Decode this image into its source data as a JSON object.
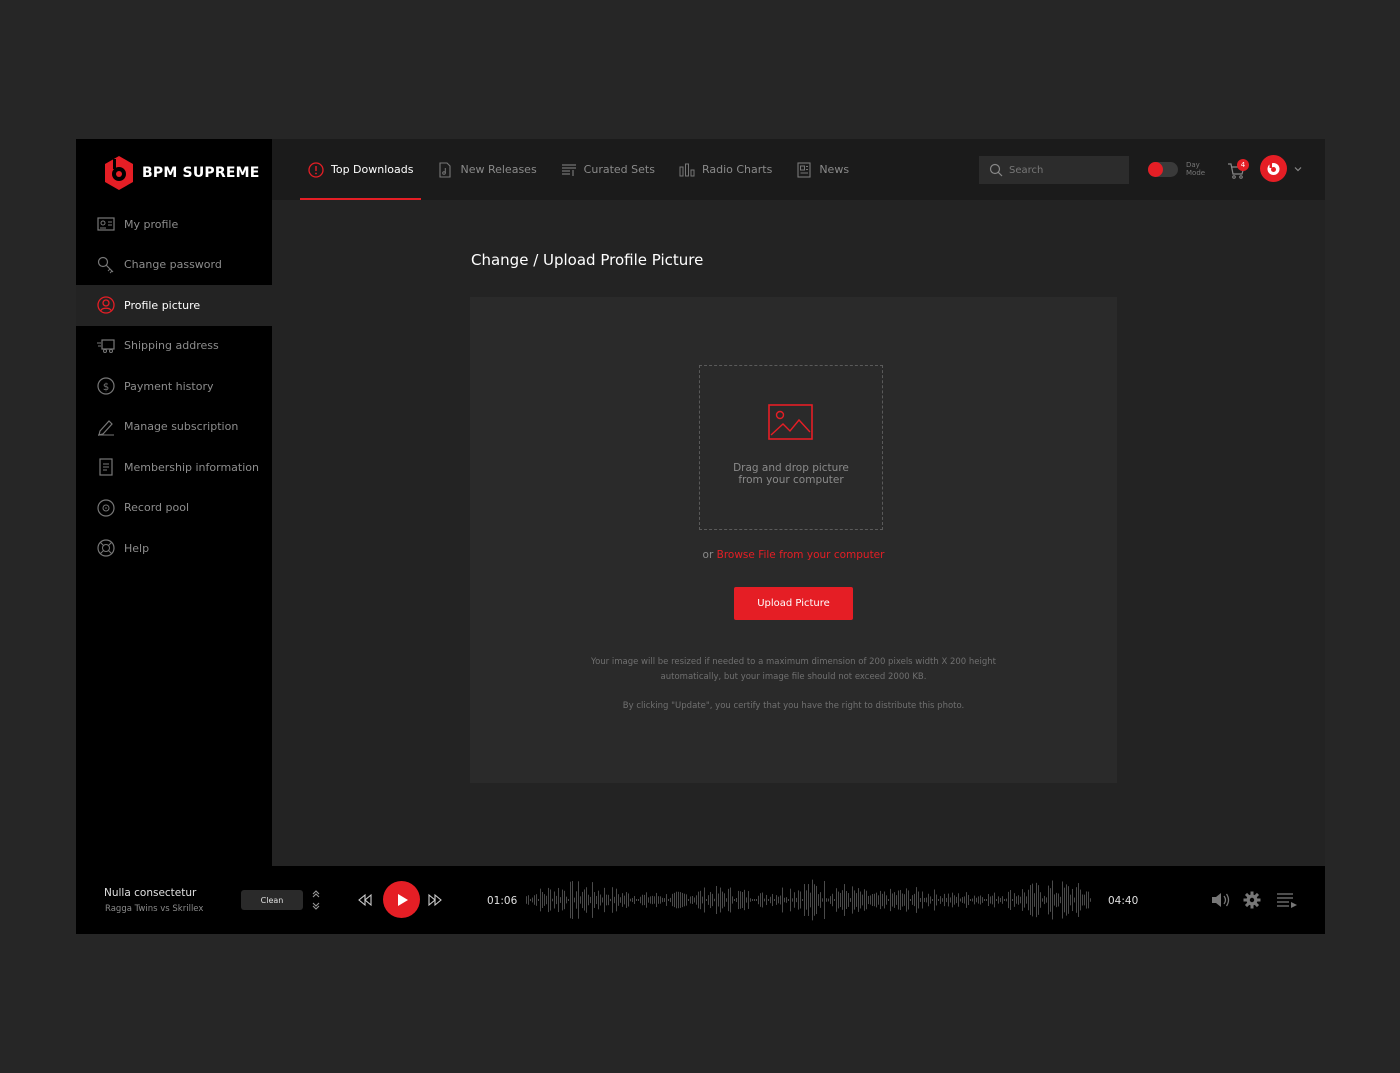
{
  "brand": {
    "name": "BPM SUPREME",
    "accent": "#e51e25"
  },
  "sidebar": {
    "items": [
      {
        "label": "My profile",
        "icon": "profile-card-icon",
        "active": false
      },
      {
        "label": "Change password",
        "icon": "key-icon",
        "active": false
      },
      {
        "label": "Profile picture",
        "icon": "user-circle-icon",
        "active": true
      },
      {
        "label": "Shipping address",
        "icon": "truck-icon",
        "active": false
      },
      {
        "label": "Payment history",
        "icon": "dollar-circle-icon",
        "active": false
      },
      {
        "label": "Manage subscription",
        "icon": "pencil-icon",
        "active": false
      },
      {
        "label": "Membership information",
        "icon": "document-icon",
        "active": false
      },
      {
        "label": "Record pool",
        "icon": "disc-icon",
        "active": false
      },
      {
        "label": "Help",
        "icon": "lifebuoy-icon",
        "active": false
      }
    ]
  },
  "topbar": {
    "tabs": [
      {
        "label": "Top Downloads",
        "icon": "download-circle-icon",
        "active": true
      },
      {
        "label": "New Releases",
        "icon": "music-file-icon",
        "active": false
      },
      {
        "label": "Curated Sets",
        "icon": "playlist-icon",
        "active": false
      },
      {
        "label": "Radio Charts",
        "icon": "bar-chart-icon",
        "active": false
      },
      {
        "label": "News",
        "icon": "newspaper-icon",
        "active": false
      }
    ],
    "search_placeholder": "Search",
    "day_mode_line1": "Day",
    "day_mode_line2": "Mode",
    "cart_count": "4"
  },
  "main": {
    "title": "Change / Upload Profile Picture",
    "dropzone_line1": "Drag and drop picture",
    "dropzone_line2": "from your computer",
    "or_text": "or",
    "browse_link": "Browse File from your computer",
    "upload_button": "Upload Picture",
    "note_line1": "Your image will be resized if needed to a maximum dimension of 200 pixels width X 200 height",
    "note_line2": "automatically, but your image file should not exceed 2000 KB.",
    "note_line3": "By clicking \"Update\", you certify that you have the right to distribute this photo."
  },
  "player": {
    "track_title": "Nulla consectetur",
    "track_artist": "Ragga Twins vs Skrillex",
    "version": "Clean",
    "current_time": "01:06",
    "total_time": "04:40"
  }
}
